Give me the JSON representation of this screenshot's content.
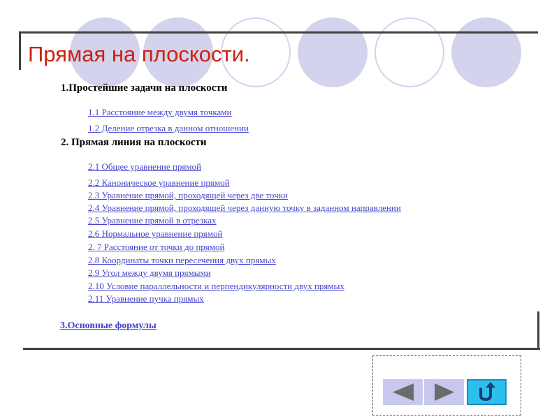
{
  "title": "Прямая на плоскости.",
  "section1": {
    "heading": "1.Простейшие задачи на плоскости",
    "links": [
      "1.1 Расстояние между двумя точками",
      "1.2 Деление отрезка в данном отношении"
    ]
  },
  "section2": {
    "heading": "2. Прямая линия на плоскости",
    "links": [
      "2.1 Общее уравнение прямой",
      "2.2 Каноническое уравнение прямой",
      "2.3 Уравнение прямой, проходящей через две точки",
      "2.4 Уравнение прямой, проходящей через данную точку в заданном направлении",
      "2.5 Уравнение прямой в отрезках",
      "2.6 Нормальное уравнение прямой",
      "2. 7 Расстояние от точки до прямой",
      "2.8 Координаты точки пересечения двух прямых",
      "2.9 Угол между двумя прямыми",
      "2.10 Условие параллельности и перпендикулярности двух прямых",
      "2.11 Уравнение пучка прямых"
    ]
  },
  "section3": {
    "link": "3.Основные формулы"
  },
  "navigation": {
    "prev_icon": "arrow-left-icon",
    "next_icon": "arrow-right-icon",
    "return_icon": "return-arrow-icon"
  },
  "colors": {
    "title": "#cc2211",
    "link": "#4444cc",
    "circle": "#d3d3ee",
    "nav_button": "#c8c8ee",
    "nav_arrow": "#6b6b6b",
    "return_button": "#2bc0ec"
  }
}
